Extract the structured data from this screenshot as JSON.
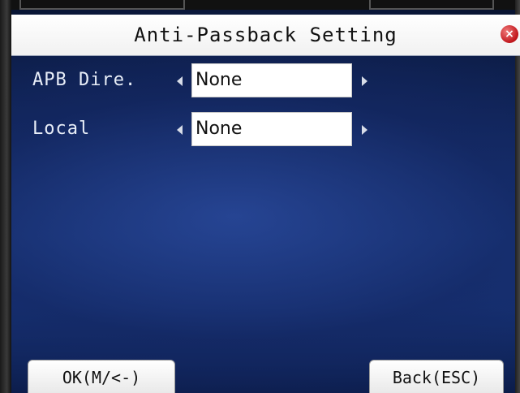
{
  "title": "Anti-Passback Setting",
  "close_label": "×",
  "settings": [
    {
      "label": "APB Dire.",
      "value": "None"
    },
    {
      "label": "Local",
      "value": "None"
    }
  ],
  "buttons": {
    "ok_label": "OK(M/<-)",
    "back_label": "Back(ESC)"
  },
  "colors": {
    "background": "#1b3d86",
    "title_bar": "#ffffff",
    "close_button": "#c0151b",
    "label_text": "#e8eef8"
  }
}
